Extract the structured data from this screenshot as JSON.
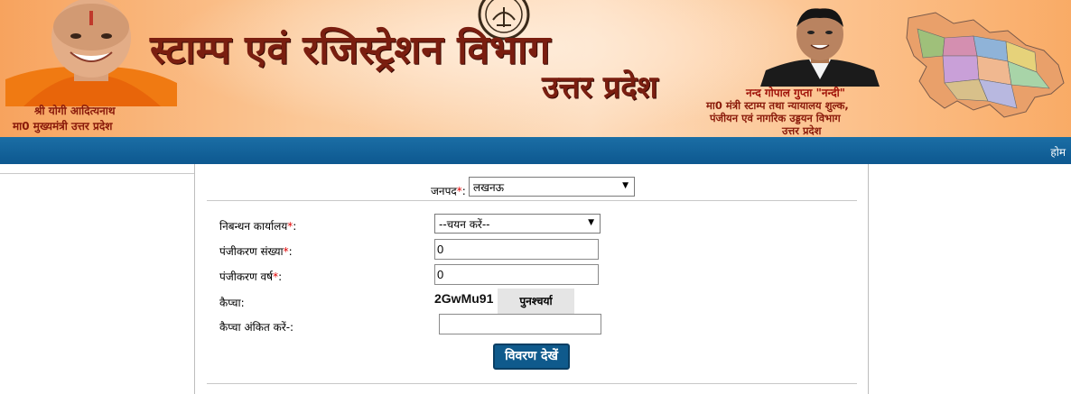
{
  "header": {
    "title": "स्टाम्प एवं रजिस्ट्रेशन विभाग",
    "subtitle": "उत्तर प्रदेश",
    "cm_name": "श्री योगी आदित्यनाथ",
    "cm_title": "मा0 मुख्यमंत्री उत्तर प्रदेश",
    "minister_name": "नन्द गोपाल गुप्ता \"नन्दी\"",
    "minister_line1": "मा0  मंत्री स्टाम्प तथा न्यायालय शुल्क,",
    "minister_line2": "पंजीयन एवं नागरिक उड्डयन विभाग",
    "minister_line3": "उत्तर प्रदेश"
  },
  "nav": {
    "home_label": "होम"
  },
  "form": {
    "district_label": "जनपद",
    "district_value": "लखनऊ",
    "office_label": "निबन्धन कार्यालय",
    "office_value": "--चयन करें--",
    "reg_no_label": "पंजीकरण संख्या",
    "reg_no_value": "0",
    "reg_year_label": "पंजीकरण वर्ष",
    "reg_year_value": "0",
    "captcha_label": "कैप्चा:",
    "captcha_value": "2GwMu91",
    "refresh_label": "पुनश्चर्या",
    "captcha_input_label": "कैप्चा अंकित करें-:",
    "captcha_input_value": "",
    "submit_label": "विवरण देखें",
    "required_mark": "*",
    "colon": ":"
  },
  "colors": {
    "nav_bg": "#0d5890",
    "submit_bg": "#0f5a8c",
    "title_color": "#7a1e10",
    "required": "#e00000"
  }
}
